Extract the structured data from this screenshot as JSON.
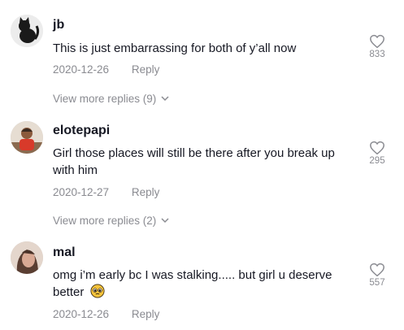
{
  "comments": [
    {
      "username": "jb",
      "text": "This is just embarrassing for both of y’all now",
      "date": "2020-12-26",
      "reply_label": "Reply",
      "likes": "833",
      "view_more": "View more replies (9)",
      "avatar_icon": "black-cat-avatar"
    },
    {
      "username": "elotepapi",
      "text": "Girl those places will still be there after you break up with him",
      "date": "2020-12-27",
      "reply_label": "Reply",
      "likes": "295",
      "view_more": "View more replies (2)",
      "avatar_icon": "person-avatar"
    },
    {
      "username": "mal",
      "text": "omg i’m early bc I was stalking..... but girl u deserve better",
      "date": "2020-12-26",
      "reply_label": "Reply",
      "likes": "557",
      "avatar_icon": "selfie-avatar",
      "emoji_icon": "pleading-face-emoji"
    }
  ],
  "colors": {
    "text": "#161823",
    "secondary": "#8a8b91"
  }
}
